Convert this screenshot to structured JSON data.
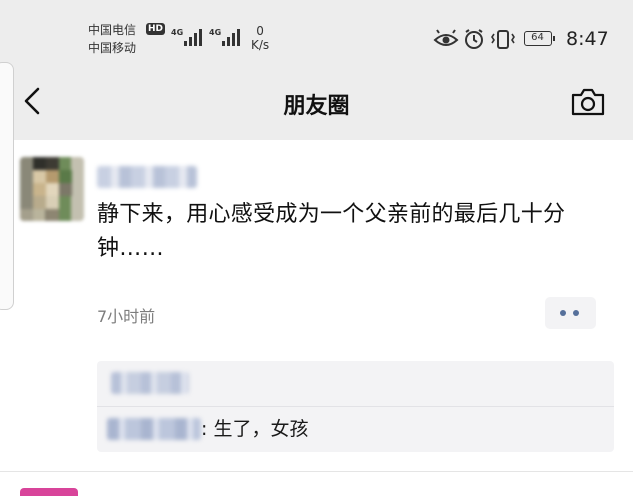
{
  "status_bar": {
    "carrier_1": "中国电信",
    "carrier_2": "中国移动",
    "hd_badge": "HD",
    "signal_1_label": "4G",
    "signal_2_label": "4G",
    "net_speed_value": "0",
    "net_speed_unit": "K/s",
    "battery_level": "64",
    "time": "8:47",
    "icons": [
      "eye-icon",
      "alarm-icon",
      "vibrate-icon",
      "battery-icon"
    ]
  },
  "nav": {
    "title": "朋友圈",
    "back_icon": "chevron-left-icon",
    "camera_icon": "camera-icon"
  },
  "post": {
    "author": "",
    "text": "静下来，用心感受成为一个父亲前的最后几十分钟……",
    "time": "7小时前",
    "more_icon": "more-dots-icon",
    "likes": "",
    "comments": [
      {
        "author": "",
        "separator": ":",
        "text": "生了，女孩"
      }
    ]
  },
  "colors": {
    "header_bg": "#ededed",
    "link_blue": "#56709b",
    "comment_bg": "#f3f3f5",
    "time_gray": "#7d7d7d"
  }
}
